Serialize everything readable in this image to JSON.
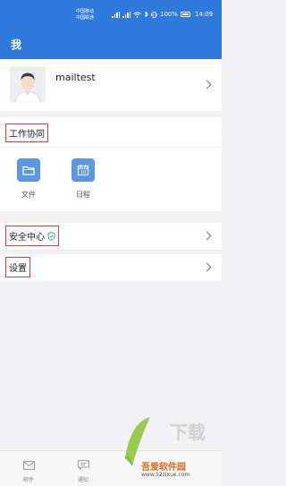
{
  "status_bar": {
    "carrier_1": "中国移动",
    "carrier_2": "中国联通",
    "battery": "100%",
    "time": "14:09"
  },
  "header": {
    "title": "我"
  },
  "profile": {
    "username": "mailtest"
  },
  "work": {
    "title": "工作协同",
    "apps": [
      {
        "label": "文件",
        "icon": "folder-icon"
      },
      {
        "label": "日程",
        "icon": "calendar-icon",
        "day": "10"
      }
    ]
  },
  "rows": {
    "security": "安全中心",
    "settings": "设置"
  },
  "bottom_nav": {
    "mail": "邮件",
    "notice": "通知"
  },
  "watermark": {
    "brand": "吾爱软件园",
    "url": "www.52zixue.com",
    "logo_text": "下载"
  },
  "colors": {
    "primary": "#2f79dd",
    "app_icon": "#5b96e3",
    "highlight": "#e23a3a",
    "shield": "#2eaa5b"
  }
}
